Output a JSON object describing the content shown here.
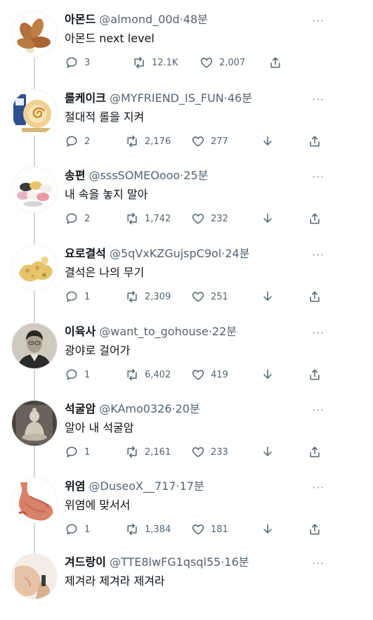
{
  "more_label": "···",
  "tweets": [
    {
      "name": "아몬드",
      "handle": "@almond_00d",
      "sep": "·",
      "time": "48분",
      "text": "아몬드 next level",
      "replies": "3",
      "retweets": "12.1K",
      "likes": "2,007",
      "avatar_icon": "almond-avatar"
    },
    {
      "name": "롤케이크",
      "handle": "@MYFRIEND_IS_FUN",
      "sep": "·",
      "time": "46분",
      "text": "절대적 롤을 지켜",
      "replies": "2",
      "retweets": "2,176",
      "likes": "277",
      "avatar_icon": "roll-cake-avatar"
    },
    {
      "name": "송편",
      "handle": "@sssSOMEOooo",
      "sep": "·",
      "time": "25분",
      "text": "내 속을 놓지 말아",
      "replies": "2",
      "retweets": "1,742",
      "likes": "232",
      "avatar_icon": "songpyeon-avatar"
    },
    {
      "name": "요로결석",
      "handle": "@5qVxKZGujspC9ol",
      "sep": "·",
      "time": "24분",
      "text": "결석은 나의 무기",
      "replies": "1",
      "retweets": "2,309",
      "likes": "251",
      "avatar_icon": "kidney-stone-avatar"
    },
    {
      "name": "이육사",
      "handle": "@want_to_gohouse",
      "sep": "·",
      "time": "22분",
      "text": "광야로 걸어가",
      "replies": "1",
      "retweets": "6,402",
      "likes": "419",
      "avatar_icon": "portrait-avatar"
    },
    {
      "name": "석굴암",
      "handle": "@KAmo0326",
      "sep": "·",
      "time": "20분",
      "text": "알아 내 석굴암",
      "replies": "1",
      "retweets": "2,161",
      "likes": "233",
      "avatar_icon": "buddha-statue-avatar"
    },
    {
      "name": "위염",
      "handle": "@DuseoX__717",
      "sep": "·",
      "time": "17분",
      "text": "위염에 맞서서",
      "replies": "1",
      "retweets": "1,384",
      "likes": "181",
      "avatar_icon": "stomach-avatar"
    },
    {
      "name": "겨드랑이",
      "handle": "@TTE8lwFG1qsql55",
      "sep": "·",
      "time": "16분",
      "text": "제겨라 제겨라 제겨라",
      "avatar_icon": "armpit-avatar"
    }
  ],
  "colors": {
    "text": "#0f1419",
    "muted": "#536471",
    "line": "#cfd9de"
  }
}
